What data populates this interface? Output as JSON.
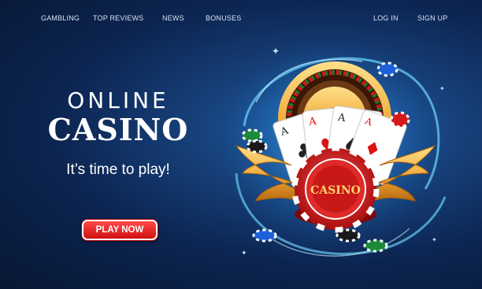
{
  "nav": {
    "left": [
      "GAMBLING",
      "TOP REVIEWS",
      "NEWS",
      "BONUSES"
    ],
    "right": [
      "LOG IN",
      "SIGN UP"
    ]
  },
  "hero": {
    "title_top": "ONLINE",
    "title_main": "CASINO",
    "tagline": "It’s time to play!",
    "cta": "PLAY NOW",
    "chip_label": "CASINO"
  },
  "icons": [
    "roulette-wheel-icon",
    "playing-cards-icon",
    "casino-chip-icon",
    "wings-icon",
    "poker-chip-icon"
  ],
  "colors": {
    "background": "#0c2450",
    "button": "#e31b1b",
    "gold": "#f0a93a",
    "glow": "#3fc3ff"
  }
}
